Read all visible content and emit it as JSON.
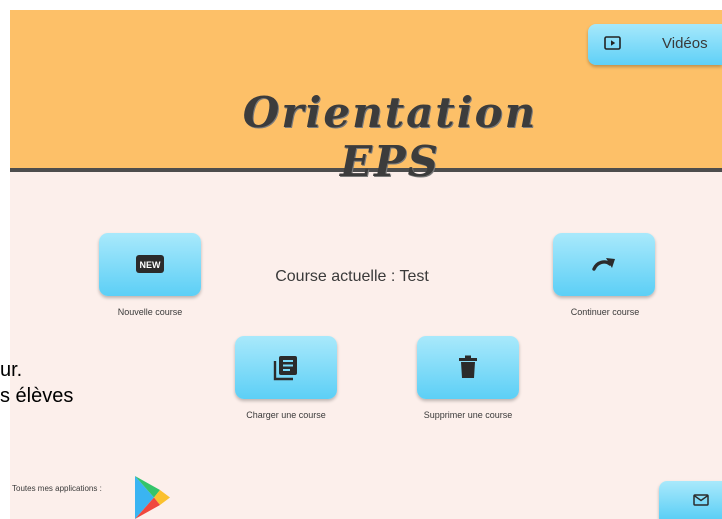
{
  "app": {
    "title": "Orientation EPS"
  },
  "header": {
    "videos_label": "Vidéos",
    "videos_icon": "video-play-icon"
  },
  "main": {
    "current_course_label": "Course actuelle : Test",
    "buttons": {
      "new_course": {
        "label": "Nouvelle course",
        "icon": "new-badge-icon"
      },
      "continue_course": {
        "label": "Continuer course",
        "icon": "redo-arrow-icon"
      },
      "load_course": {
        "label": "Charger une course",
        "icon": "documents-icon"
      },
      "delete_course": {
        "label": "Supprimer une course",
        "icon": "trash-icon"
      }
    },
    "new_badge_text": "NEW"
  },
  "bleed_text": {
    "line1": "ur.",
    "line2": "s élèves"
  },
  "footer": {
    "apps_label": "Toutes mes applications :",
    "store_icon": "google-play-icon",
    "mail_icon": "mail-icon"
  },
  "colors": {
    "header_bg": "#fdc068",
    "main_bg": "#fcefeb",
    "button_gradient_top": "#a9e9fb",
    "button_gradient_bottom": "#5ccff6",
    "title_color": "#3c3c3c"
  }
}
